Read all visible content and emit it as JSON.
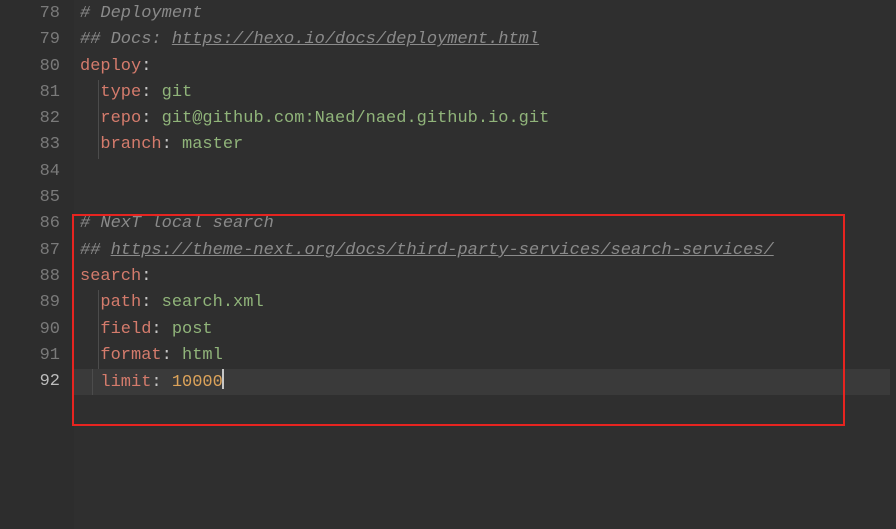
{
  "lines": {
    "l78_num": "78",
    "l78_text": "# Deployment",
    "l79_num": "79",
    "l79_a": "## Docs: ",
    "l79_b": "https://hexo.io/docs/deployment.html",
    "l80_num": "80",
    "l80_key": "deploy",
    "l81_num": "81",
    "l81_key": "type",
    "l81_val": "git",
    "l82_num": "82",
    "l82_key": "repo",
    "l82_val": "git@github.com:Naed/naed.github.io.git",
    "l83_num": "83",
    "l83_key": "branch",
    "l83_val": "master",
    "l84_num": "84",
    "l85_num": "85",
    "l86_num": "86",
    "l86_text": "# NexT local search",
    "l87_num": "87",
    "l87_a": "## ",
    "l87_b": "https://theme-next.org/docs/third-party-services/search-services/",
    "l88_num": "88",
    "l88_key": "search",
    "l89_num": "89",
    "l89_key": "path",
    "l89_val": "search.xml",
    "l90_num": "90",
    "l90_key": "field",
    "l90_val": "post",
    "l91_num": "91",
    "l91_key": "format",
    "l91_val": "html",
    "l92_num": "92",
    "l92_key": "limit",
    "l92_val": "10000"
  }
}
